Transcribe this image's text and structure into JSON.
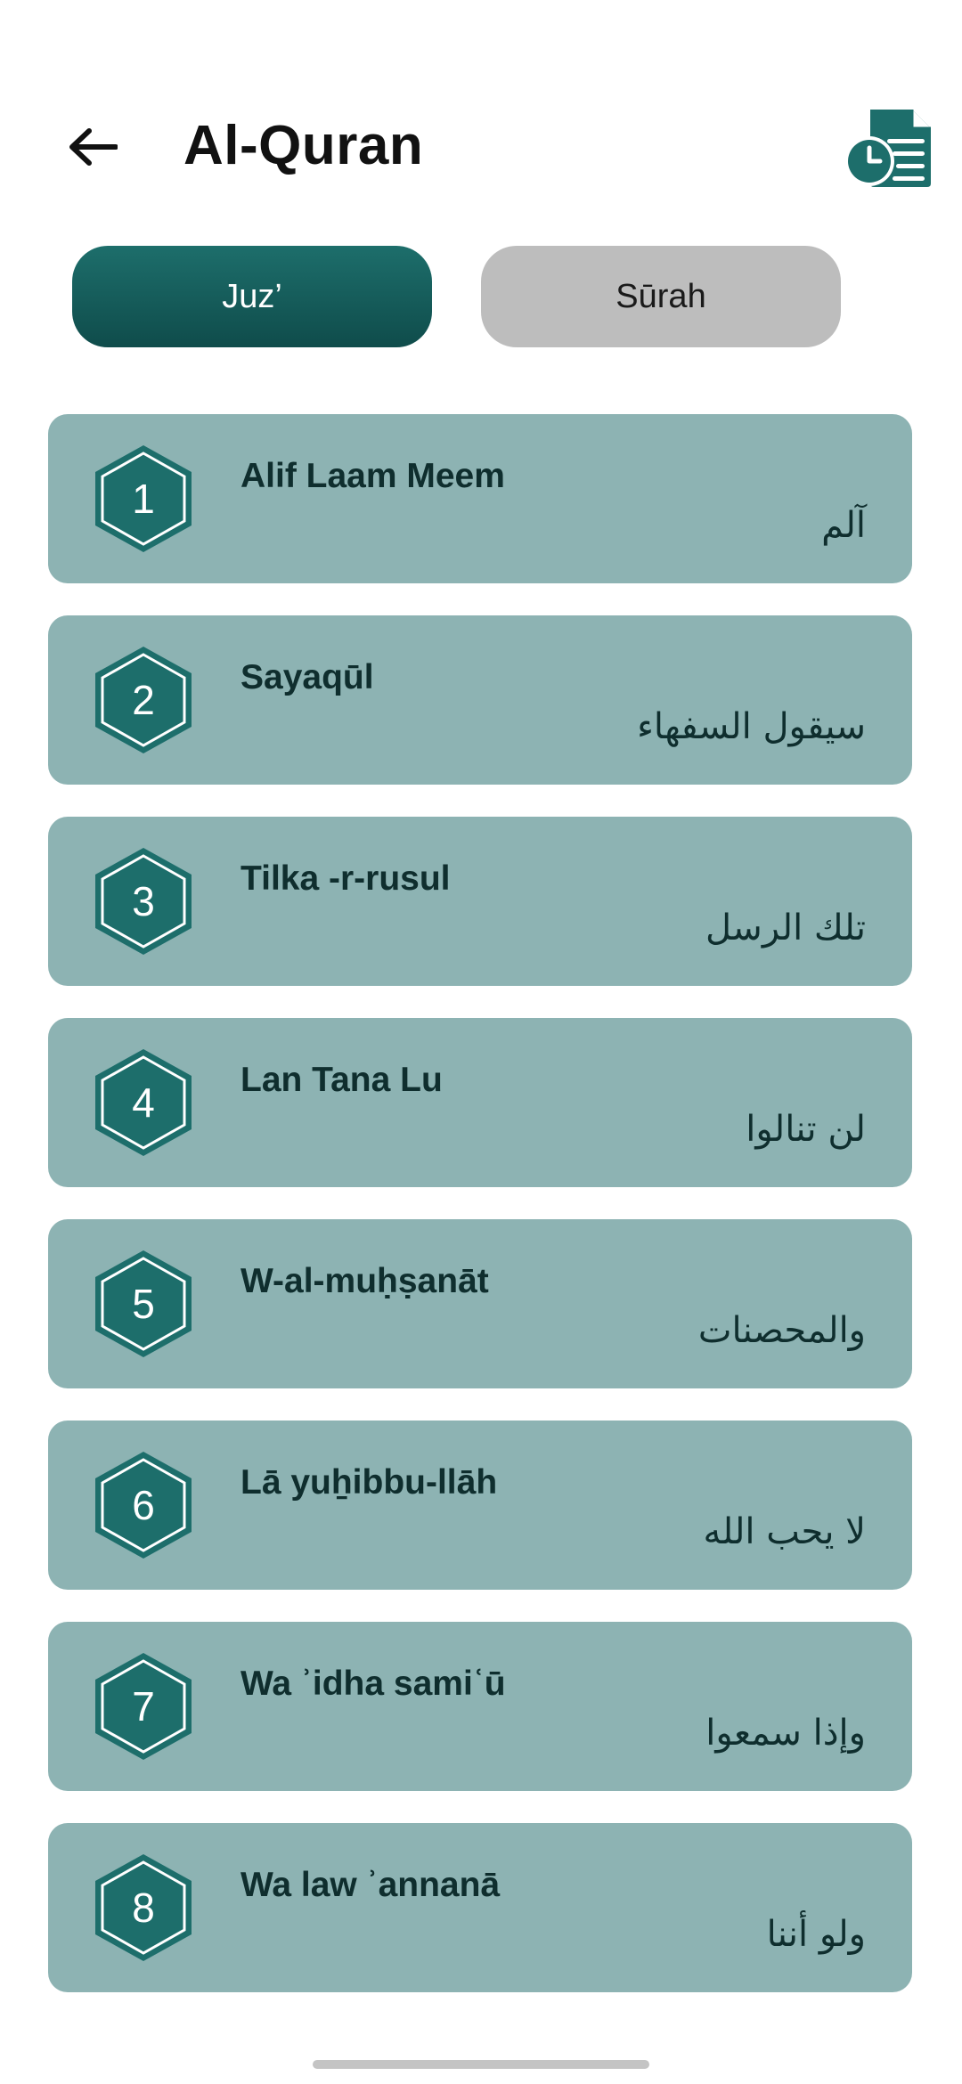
{
  "header": {
    "title": "Al-Quran",
    "back_icon": "arrow-left-icon",
    "history_icon": "document-clock-icon"
  },
  "tabs": [
    {
      "label": "Juz’",
      "active": true
    },
    {
      "label": "Sūrah",
      "active": false
    }
  ],
  "colors": {
    "accent": "#1d6e6b",
    "card": "#8db3b3",
    "inactive_tab": "#bdbdbd"
  },
  "juz_list": [
    {
      "number": "1",
      "name": "Alif Laam Meem",
      "arabic": "آلم"
    },
    {
      "number": "2",
      "name": "Sayaqūl",
      "arabic": "سيقول السفهاء"
    },
    {
      "number": "3",
      "name": "Tilka -r-rusul",
      "arabic": "تلك الرسل"
    },
    {
      "number": "4",
      "name": "Lan Tana Lu",
      "arabic": "لن تنالوا"
    },
    {
      "number": "5",
      "name": "W-al-muḥṣanāt",
      "arabic": "والمحصنات"
    },
    {
      "number": "6",
      "name": "Lā yuẖibbu-llāh",
      "arabic": "لا يحب الله"
    },
    {
      "number": "7",
      "name": "Wa ʾidha samiʿū",
      "arabic": "وإذا سمعوا"
    },
    {
      "number": "8",
      "name": "Wa law ʾannanā",
      "arabic": "ولو أننا"
    }
  ]
}
